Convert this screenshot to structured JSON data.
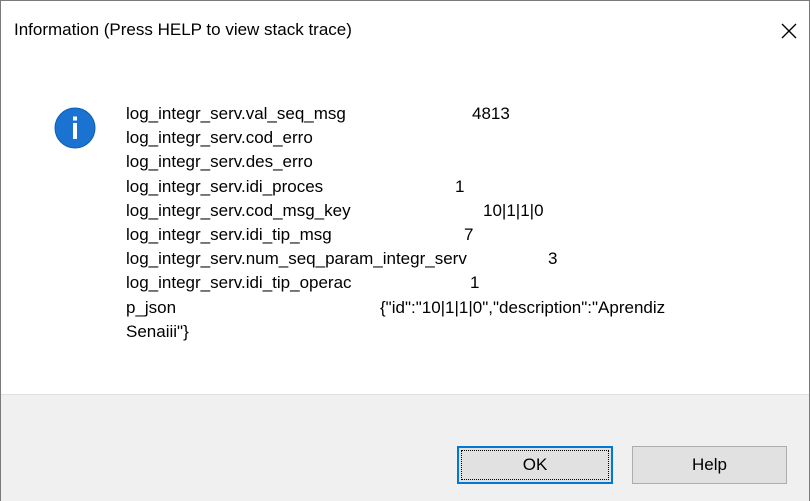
{
  "window": {
    "title": "Information (Press HELP to view stack trace)",
    "close_icon": "close-icon"
  },
  "message": {
    "icon": "information-icon",
    "icon_color": "#1a73d0",
    "rows": [
      {
        "key": "log_integr_serv.val_seq_msg",
        "value": "4813"
      },
      {
        "key": "log_integr_serv.cod_erro",
        "value": ""
      },
      {
        "key": "log_integr_serv.des_erro",
        "value": ""
      },
      {
        "key": "log_integr_serv.idi_proces",
        "value": "1"
      },
      {
        "key": "log_integr_serv.cod_msg_key",
        "value": "10|1|1|0"
      },
      {
        "key": "log_integr_serv.idi_tip_msg",
        "value": "7"
      },
      {
        "key": "log_integr_serv.num_seq_param_integr_serv",
        "value": "3"
      },
      {
        "key": "log_integr_serv.idi_tip_operac",
        "value": "1"
      }
    ],
    "json_key": "p_json",
    "json_value": "{\"id\":\"10|1|1|0\",\"description\":\"Aprendiz",
    "json_value_cont": "Senaiii\"}"
  },
  "buttons": {
    "ok_label": "OK",
    "help_label": "Help",
    "focus_color": "#0078d7"
  }
}
